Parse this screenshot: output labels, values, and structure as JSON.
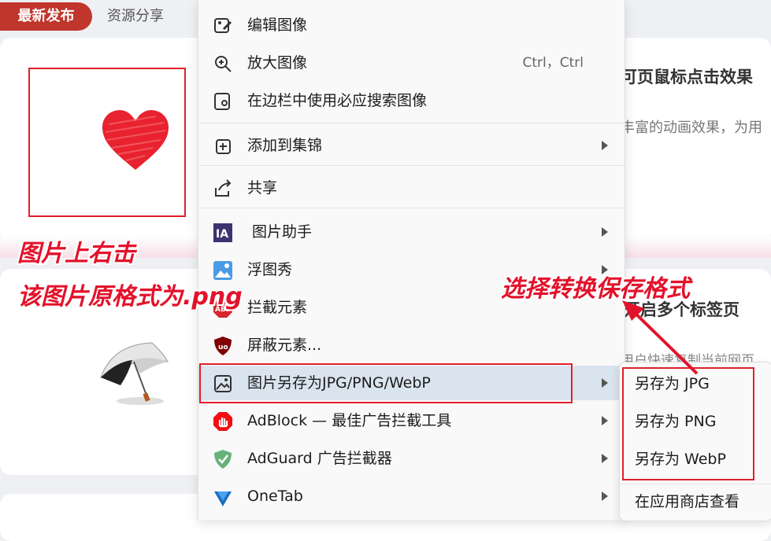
{
  "tabs": [
    {
      "label": "最新发布",
      "active": true
    },
    {
      "label": "资源分享",
      "active": false
    }
  ],
  "background": {
    "card1_title": "可页鼠标点击效果",
    "card1_desc": "丰富的动画效果，为用",
    "card2_title": "开启多个标签页",
    "card2_desc": "用户快速复制当前网页"
  },
  "annotations": {
    "line1": "图片上右击",
    "line2": "该图片原格式为.png",
    "line3": "选择转换保存格式"
  },
  "context_menu": {
    "items": [
      {
        "label": "编辑图像",
        "icon": "edit-image-icon"
      },
      {
        "label": "放大图像",
        "icon": "zoom-in-icon",
        "shortcut": "Ctrl，Ctrl"
      },
      {
        "label": "在边栏中使用必应搜索图像",
        "icon": "visual-search-icon"
      },
      {
        "label": "添加到集锦",
        "icon": "collections-add-icon",
        "submenu": true
      },
      {
        "label": "共享",
        "icon": "share-icon"
      },
      {
        "label": "图片助手",
        "icon": "ia-image-assistant-icon",
        "submenu": true
      },
      {
        "label": "浮图秀",
        "icon": "image-preview-icon",
        "submenu": true
      },
      {
        "label": "拦截元素",
        "icon": "abp-icon"
      },
      {
        "label": "屏蔽元素...",
        "icon": "ublock-icon"
      },
      {
        "label": "图片另存为JPG/PNG/WebP",
        "icon": "image-save-icon",
        "submenu": true,
        "highlighted": true
      },
      {
        "label": "AdBlock — 最佳广告拦截工具",
        "icon": "adblock-icon",
        "submenu": true
      },
      {
        "label": "AdGuard 广告拦截器",
        "icon": "adguard-icon",
        "submenu": true
      },
      {
        "label": "OneTab",
        "icon": "onetab-icon",
        "submenu": true
      }
    ]
  },
  "submenu": {
    "items": [
      {
        "label": "另存为 JPG"
      },
      {
        "label": "另存为 PNG"
      },
      {
        "label": "另存为 WebP"
      },
      {
        "label": "在应用商店查看"
      }
    ]
  },
  "colors": {
    "accent_red": "#e0202a",
    "tab_active": "#c0362c",
    "menu_highlight": "#d9e4ef"
  }
}
